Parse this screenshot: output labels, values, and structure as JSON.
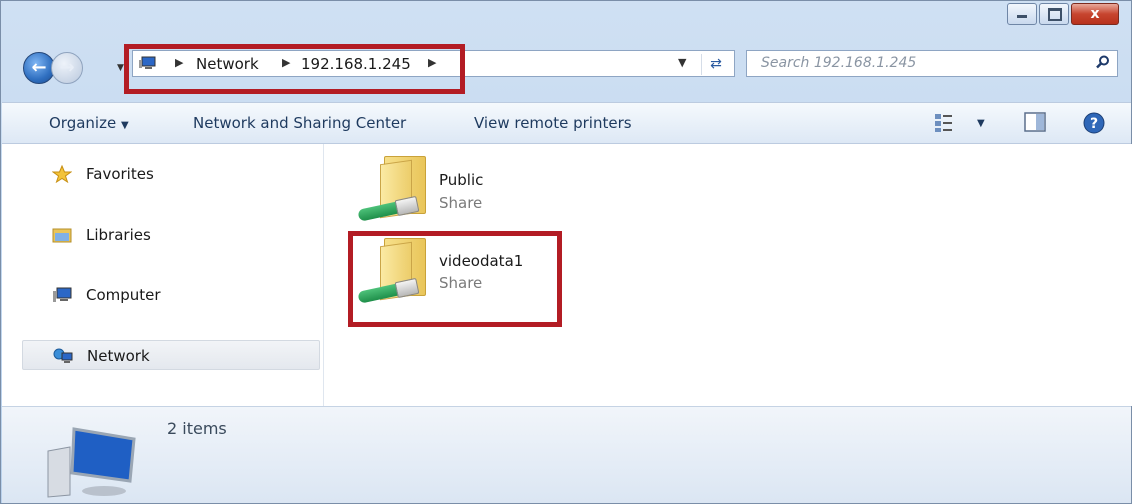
{
  "window": {
    "controls": {
      "minimize": "minimize",
      "maximize": "maximize",
      "close": "x"
    }
  },
  "address": {
    "segments": [
      "Network",
      "192.168.1.245"
    ],
    "search_placeholder": "Search 192.168.1.245"
  },
  "toolbar": {
    "organize_label": "Organize",
    "network_center_label": "Network and Sharing Center",
    "remote_printers_label": "View remote printers"
  },
  "navpane": {
    "items": [
      {
        "label": "Favorites",
        "icon": "star-icon"
      },
      {
        "label": "Libraries",
        "icon": "libraries-icon"
      },
      {
        "label": "Computer",
        "icon": "computer-icon"
      },
      {
        "label": "Network",
        "icon": "network-icon",
        "selected": true
      }
    ]
  },
  "content": {
    "items": [
      {
        "name": "Public",
        "type": "Share"
      },
      {
        "name": "videodata1",
        "type": "Share"
      }
    ]
  },
  "details": {
    "count_text": "2 items"
  },
  "colors": {
    "highlight_box": "#b31c24",
    "toolbar_text": "#1e3a5f"
  }
}
